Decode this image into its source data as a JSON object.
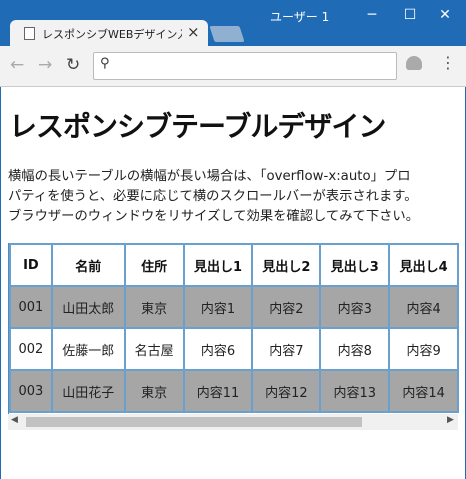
{
  "window": {
    "user": "ユーザー 1",
    "minimize_icon": "─",
    "maximize_icon": "☐",
    "close_icon": "✕"
  },
  "tab": {
    "title": "レスポンシブWEBデザイン入門",
    "close": "×"
  },
  "toolbar": {
    "back": "←",
    "forward": "→",
    "reload": "↻",
    "search_glyph": "⚲",
    "omnibox_value": "",
    "menu": "⋮"
  },
  "page": {
    "heading": "レスポンシブテーブルデザイン",
    "desc_lines": [
      "横幅の長いテーブルの横幅が長い場合は、「overflow-x:auto」プロ",
      "パティを使うと、必要に応じて横のスクロールバーが表示されます。",
      "ブラウザーのウィンドウをリサイズして効果を確認してみて下さい。"
    ]
  },
  "table": {
    "headers": [
      "ID",
      "名前",
      "住所",
      "見出し1",
      "見出し2",
      "見出し3",
      "見出し4"
    ],
    "rows": [
      [
        "001",
        "山田太郎",
        "東京",
        "内容1",
        "内容2",
        "内容3",
        "内容4"
      ],
      [
        "002",
        "佐藤一郎",
        "名古屋",
        "内容6",
        "内容7",
        "内容8",
        "内容9"
      ],
      [
        "003",
        "山田花子",
        "東京",
        "内容11",
        "内容12",
        "内容13",
        "内容14"
      ]
    ]
  },
  "scrollbar": {
    "left": "◀",
    "right": "▶"
  }
}
